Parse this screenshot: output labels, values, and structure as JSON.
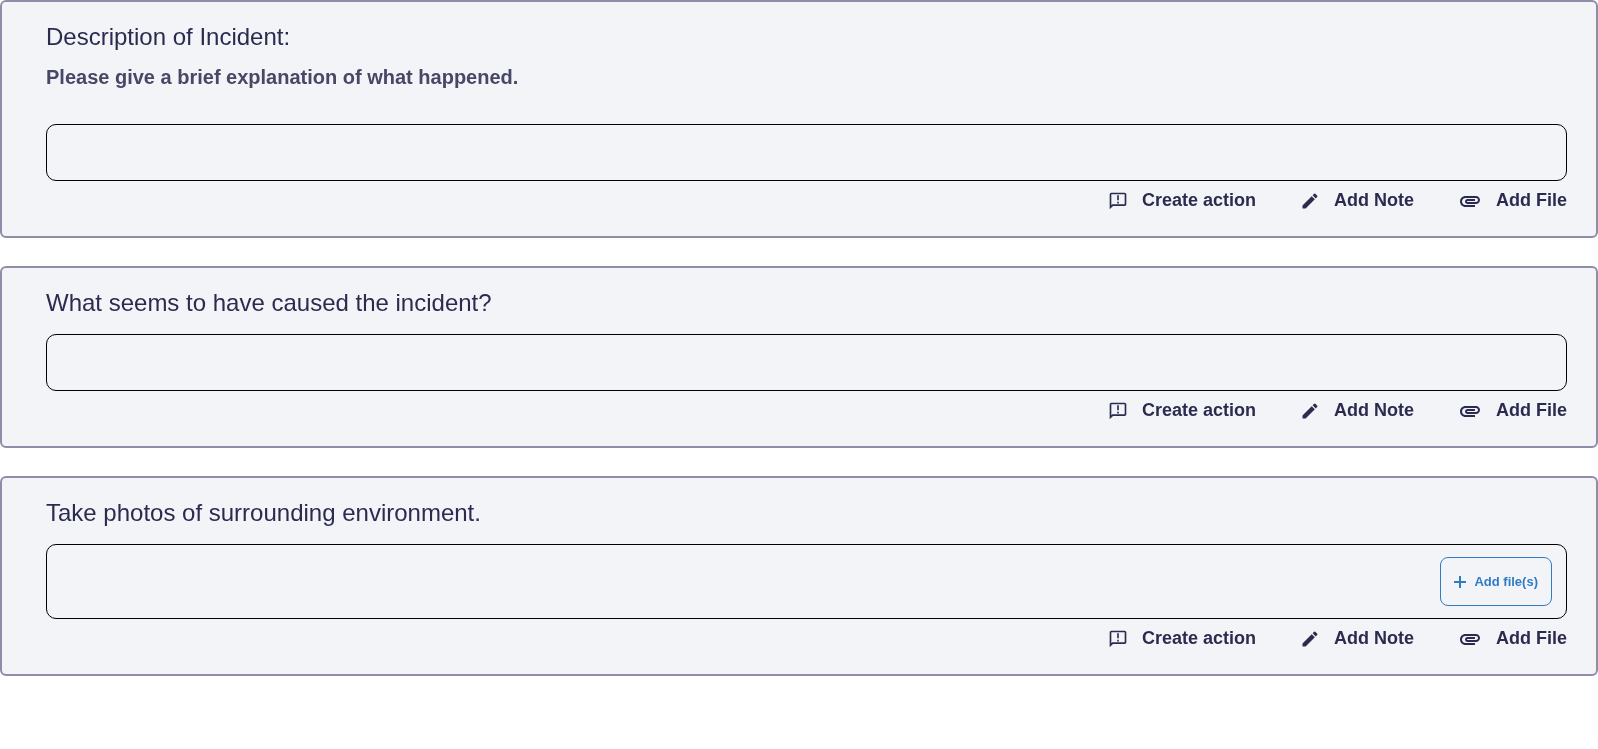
{
  "questions": [
    {
      "title": "Description of Incident:",
      "subtitle": "Please give a brief explanation of what happened.",
      "field": {
        "kind": "text"
      },
      "actions": [
        {
          "kind": "action",
          "label": "Create action"
        },
        {
          "kind": "note",
          "label": "Add Note"
        },
        {
          "kind": "file",
          "label": "Add File"
        }
      ]
    },
    {
      "title": "What seems to have caused the incident?",
      "field": {
        "kind": "text"
      },
      "actions": [
        {
          "kind": "action",
          "label": "Create action"
        },
        {
          "kind": "note",
          "label": "Add Note"
        },
        {
          "kind": "file",
          "label": "Add File"
        }
      ]
    },
    {
      "title": "Take photos of surrounding environment.",
      "field": {
        "kind": "upload",
        "button": "Add file(s)"
      },
      "actions": [
        {
          "kind": "action",
          "label": "Create action"
        },
        {
          "kind": "note",
          "label": "Add Note"
        },
        {
          "kind": "file",
          "label": "Add File"
        }
      ]
    }
  ]
}
